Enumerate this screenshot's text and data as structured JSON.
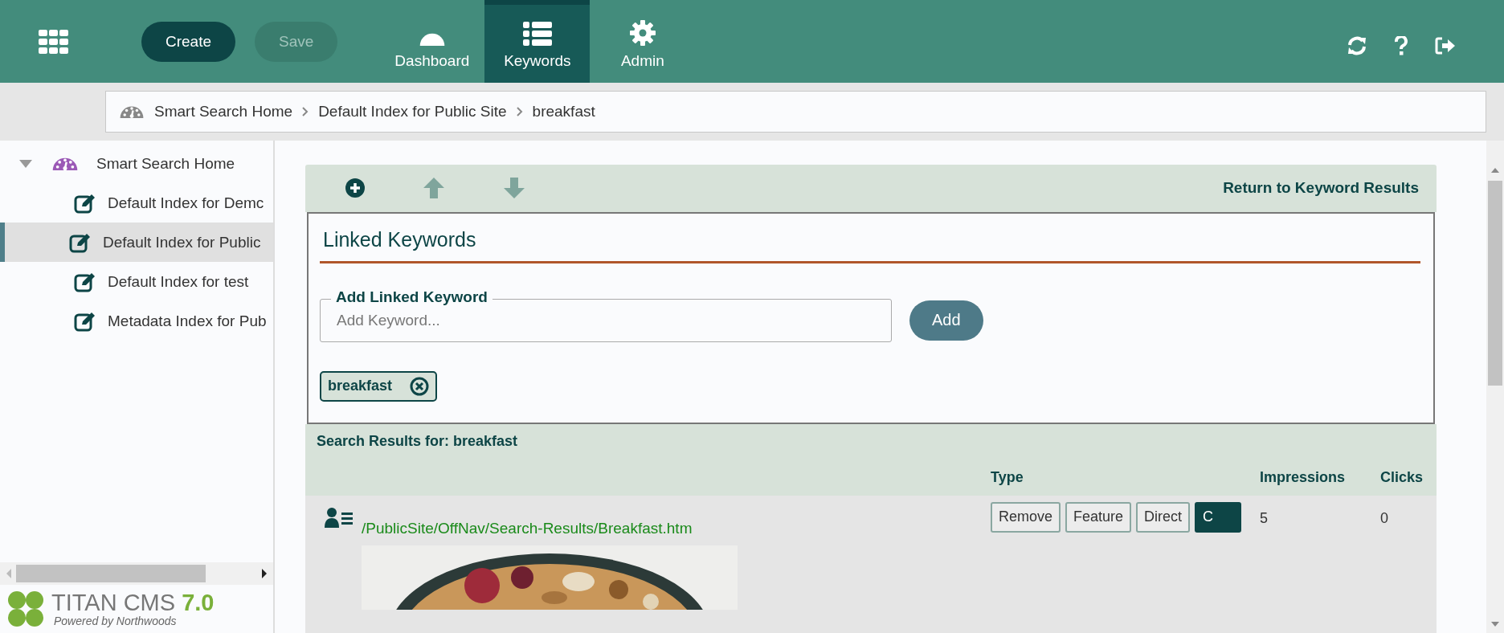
{
  "topbar": {
    "buttons": [
      {
        "label": "Create",
        "disabled": false
      },
      {
        "label": "Save",
        "disabled": true
      }
    ],
    "tabs": [
      {
        "label": "Dashboard",
        "kind": "gauge",
        "selected": false
      },
      {
        "label": "Keywords",
        "kind": "list",
        "selected": true
      },
      {
        "label": "Admin",
        "kind": "gear",
        "selected": false
      }
    ]
  },
  "breadcrumb": [
    "Smart Search Home",
    "Default Index for Public Site",
    "breakfast"
  ],
  "sidebar": {
    "tree": [
      {
        "label": "Smart Search Home",
        "expanded": true,
        "selected": false,
        "children": [
          {
            "label": "Default Index for Demc",
            "selected": false
          },
          {
            "label": "Default Index for Public",
            "selected": true
          },
          {
            "label": "Default Index for test",
            "selected": false
          },
          {
            "label": "Metadata Index for Pub",
            "selected": false
          }
        ]
      }
    ],
    "logo": {
      "name": "TITAN CMS",
      "version": "7.0",
      "tagline": "Powered by Northwoods"
    }
  },
  "toolbar": {
    "link": "Return to Keyword Results"
  },
  "linked_keywords": {
    "title": "Linked Keywords",
    "field_label": "Add Linked Keyword",
    "placeholder": "Add Keyword...",
    "button": "Add",
    "tags": [
      "breakfast"
    ]
  },
  "results": {
    "title": "Search Results for: breakfast",
    "columns": [
      "Type",
      "Impressions",
      "Clicks"
    ],
    "rows": [
      {
        "url": "/PublicSite/OffNav/Search-Results/Breakfast.htm",
        "types": [
          {
            "label": "Remove",
            "selected": false
          },
          {
            "label": "Feature",
            "selected": false
          },
          {
            "label": "Direct",
            "selected": false
          },
          {
            "label": "C",
            "selected": true
          }
        ],
        "impressions": "5",
        "clicks": "0"
      }
    ]
  }
}
